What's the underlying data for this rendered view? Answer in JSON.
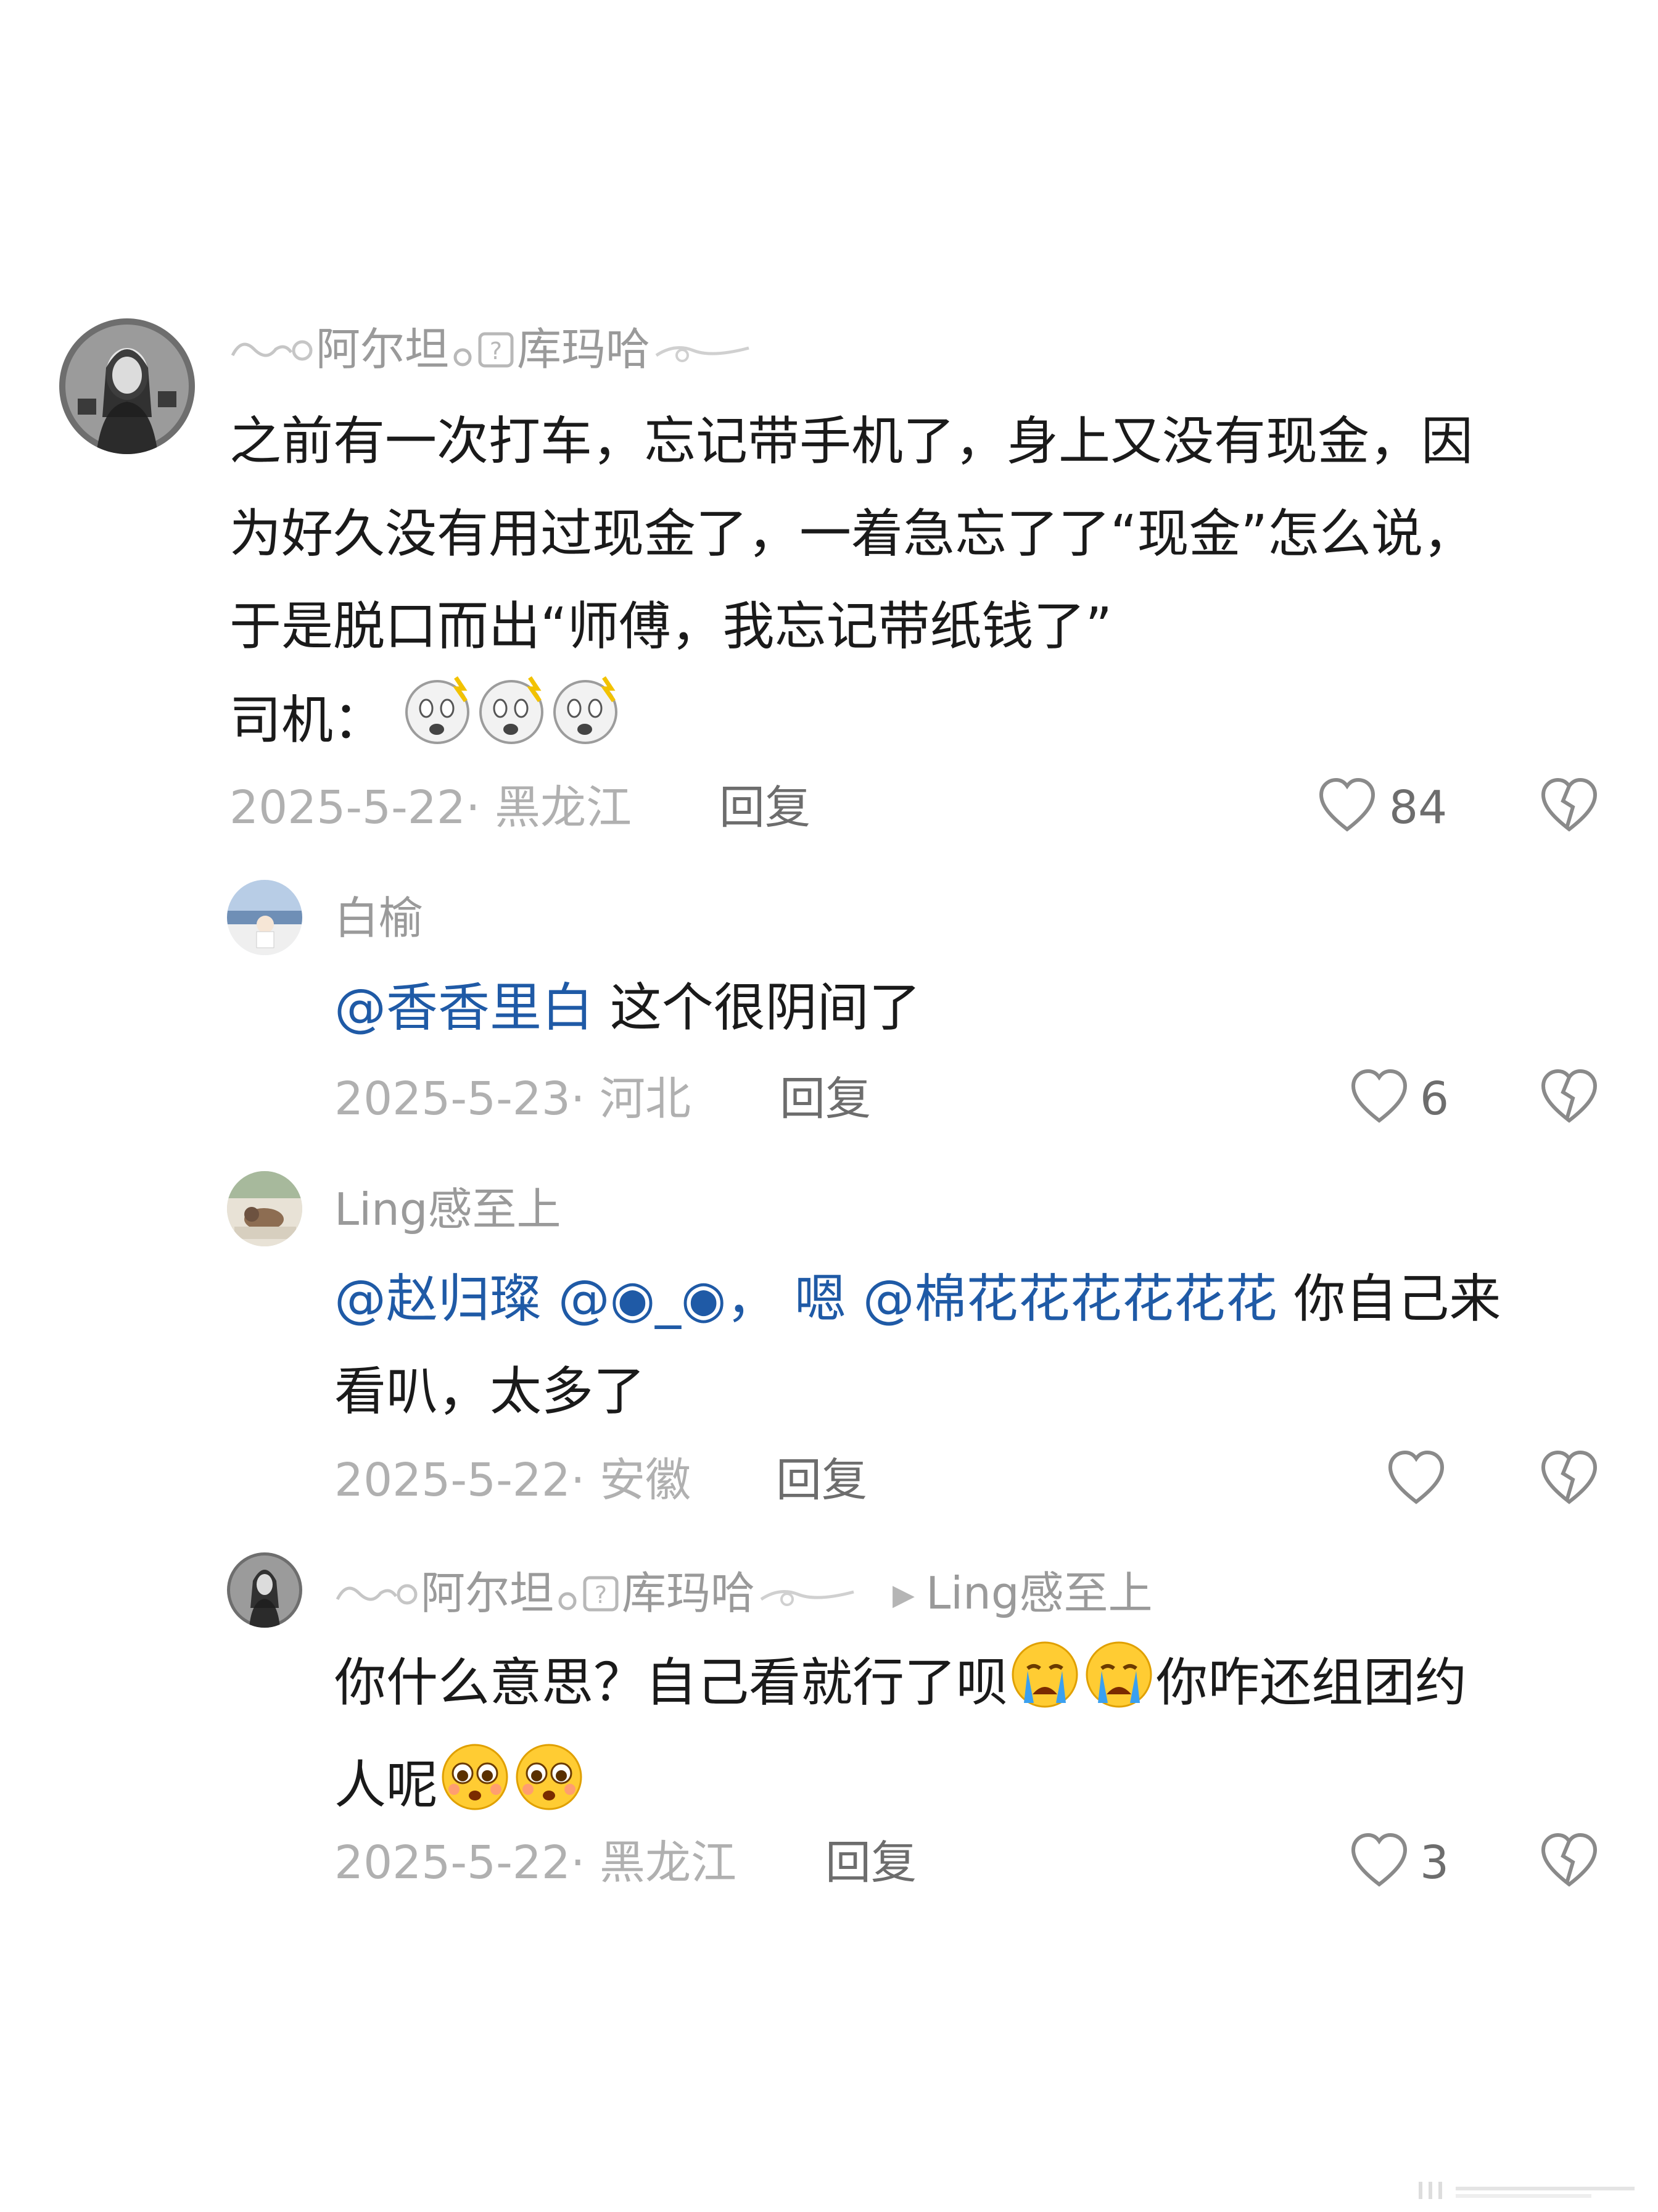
{
  "comments": [
    {
      "username": "阿尔坦",
      "username_suffix": "库玛哈",
      "text_lines": [
        "之前有一次打车，忘记带手机了，身上又没有现金，因",
        "为好久没有用过现金了，一着急忘了了“现金”怎么说，",
        "于是脱口而出“师傅，我忘记带纸钱了”"
      ],
      "last_line": "司机：",
      "emoji_icons": [
        "shocked-face-icon",
        "shocked-face-icon",
        "shocked-face-icon"
      ],
      "date_location": "2025-5-22· 黑龙江",
      "reply_label": "回复",
      "likes": "84"
    },
    {
      "username": "白榆",
      "mention": "@香香里白",
      "text": " 这个很阴间了",
      "date_location": "2025-5-23· 河北",
      "reply_label": "回复",
      "likes": "6"
    },
    {
      "username": "Ling感至上",
      "mention1": "@赵归璨",
      "mention2": " @◉_◉",
      "sep": "，",
      "mention3": "嗯 @棉花花花花花花",
      "text_tail": " 你自己来",
      "text_line2": "看叭，太多了",
      "date_location": "2025-5-22· 安徽",
      "reply_label": "回复",
      "likes": ""
    },
    {
      "username": "阿尔坦",
      "username_suffix": "库玛哈",
      "reply_arrow": "▸",
      "reply_to": "Ling感至上",
      "text_part1": "你什么意思？自己看就行了呗",
      "text_part2": "你咋还组团约",
      "text_line2": "人呢",
      "date_location": "2025-5-22· 黑龙江",
      "reply_label": "回复",
      "likes": "3"
    }
  ],
  "colors": {
    "mention": "#1f5aa6",
    "meta": "#b0b0b0",
    "name": "#9a9a9a"
  }
}
